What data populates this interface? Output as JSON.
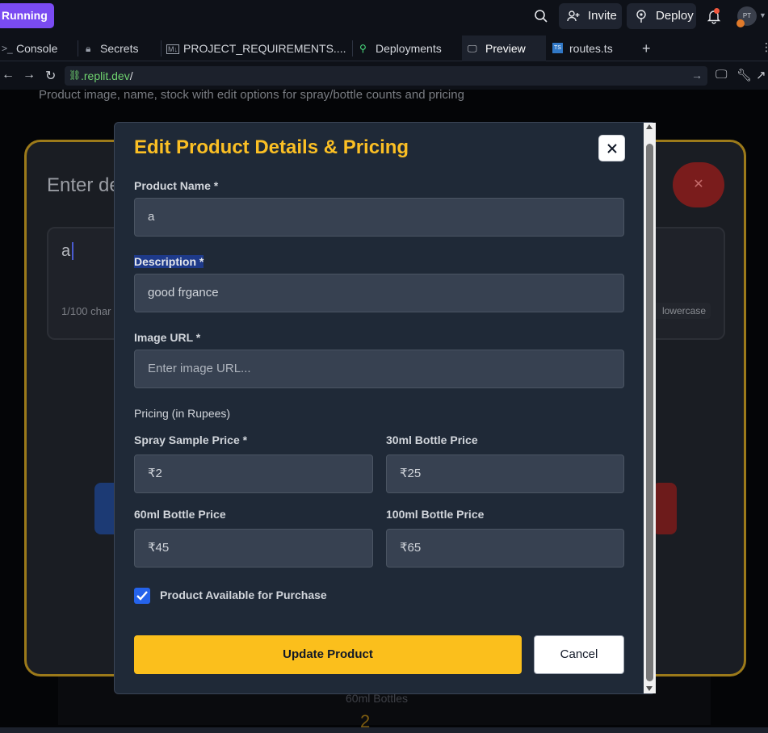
{
  "topbar": {
    "run_label": "Running",
    "invite_label": "Invite",
    "deploy_label": "Deploy",
    "avatar_initials": "PT"
  },
  "tabs": [
    {
      "label": "Console",
      "icon": "terminal-icon"
    },
    {
      "label": "Secrets",
      "icon": "lock-icon"
    },
    {
      "label": "PROJECT_REQUIREMENTS....",
      "icon": "markdown-icon"
    },
    {
      "label": "Deployments",
      "icon": "deploy-icon"
    },
    {
      "label": "Preview",
      "icon": "monitor-icon",
      "active": true
    },
    {
      "label": "routes.ts",
      "icon": "typescript-icon"
    }
  ],
  "urlbar": {
    "url": ".replit.dev",
    "url_suffix": "/"
  },
  "background": {
    "top_text": "Product image, name, stock with edit options for spray/bottle counts and pricing",
    "card_title": "Enter de",
    "input_value": "a",
    "char_count": "1/100 char",
    "lowercase_chip": "lowercase",
    "bottom_text": "60ml Bottles",
    "bottom_number": "2"
  },
  "modal": {
    "title": "Edit Product Details & Pricing",
    "product_name_label": "Product Name *",
    "product_name_value": "a",
    "description_label": "Description *",
    "description_value": "good frgance",
    "image_url_label": "Image URL *",
    "image_url_placeholder": "Enter image URL...",
    "pricing_heading": "Pricing (in Rupees)",
    "spray_label": "Spray Sample Price *",
    "spray_value": "₹2",
    "ml30_label": "30ml Bottle Price",
    "ml30_value": "₹25",
    "ml60_label": "60ml Bottle Price",
    "ml60_value": "₹45",
    "ml100_label": "100ml Bottle Price",
    "ml100_value": "₹65",
    "available_label": "Product Available for Purchase",
    "available_checked": true,
    "update_button": "Update Product",
    "cancel_button": "Cancel"
  },
  "colors": {
    "accent": "#fbbf24",
    "modal_bg": "#1f2937",
    "field_bg": "#374151",
    "checkbox": "#2563eb"
  }
}
